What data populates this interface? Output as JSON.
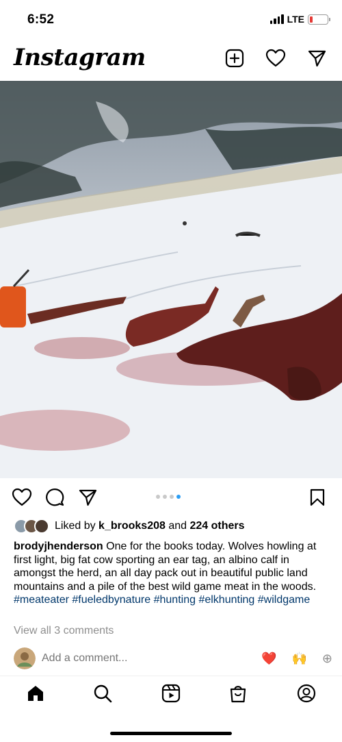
{
  "status_bar": {
    "time": "6:52",
    "network": "LTE"
  },
  "header": {
    "logo": "Instagram",
    "icons": [
      "add-post-icon",
      "heart-icon",
      "direct-message-icon"
    ]
  },
  "post": {
    "image_description_icon": "photo",
    "carousel": {
      "count": 4,
      "active_index": 3
    },
    "actions": [
      "heart-icon",
      "comment-icon",
      "share-icon",
      "bookmark-icon"
    ],
    "likes": {
      "prefix": "Liked by",
      "user": "k_brooks208",
      "joiner": "and",
      "others": "224 others"
    },
    "caption": {
      "username": "brodyjhenderson",
      "text": " One for the books today. Wolves howling at first light, big fat cow sporting an ear tag, an albino calf in amongst the herd, an all day pack out in beautiful public land mountains and a pile of the best wild game meat in the woods. ",
      "hashtags": [
        "#meateater",
        "#fueledbynature",
        "#hunting",
        "#elkhunting",
        "#wildgame"
      ]
    },
    "view_comments": "View all 3 comments",
    "comment_placeholder": "Add a comment...",
    "quick_reactions": [
      "❤️",
      "🙌",
      "⊕"
    ]
  },
  "bottom_nav": [
    "home-icon",
    "search-icon",
    "reels-icon",
    "shop-icon",
    "profile-icon"
  ],
  "colors": {
    "link": "#00376b",
    "muted": "#8e8e8e",
    "carousel_active": "#2a9df4",
    "battery_low": "#e53935"
  }
}
